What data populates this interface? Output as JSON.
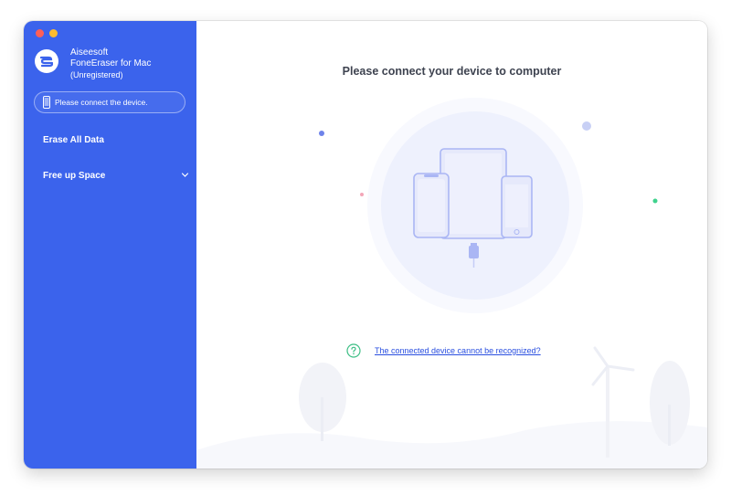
{
  "window": {
    "traffic_lights": [
      "close",
      "minimize"
    ]
  },
  "sidebar": {
    "app_title_line1": "Aiseesoft",
    "app_title_line2": "FoneEraser for Mac",
    "app_status": "(Unregistered)",
    "connect_status": "Please connect the device.",
    "items": [
      {
        "label": "Erase All Data"
      },
      {
        "label": "Free up Space",
        "icon": "chevron-down-icon"
      }
    ],
    "accent_color": "#3b63ec"
  },
  "main": {
    "title": "Please connect your device to computer",
    "help_link": "The connected device cannot be recognized?",
    "help_icon": "question-circle-icon"
  }
}
